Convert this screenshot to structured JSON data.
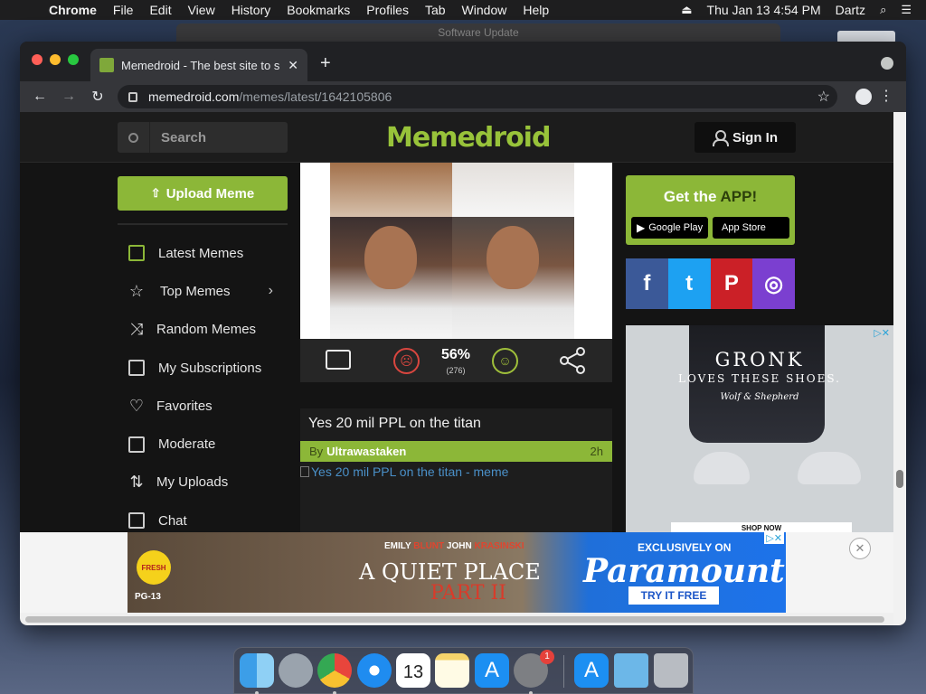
{
  "menubar": {
    "app": "Chrome",
    "items": [
      "File",
      "Edit",
      "View",
      "History",
      "Bookmarks",
      "Profiles",
      "Tab",
      "Window",
      "Help"
    ],
    "datetime": "Thu Jan 13  4:54 PM",
    "user": "Dartz"
  },
  "background_window": {
    "title": "Software Update"
  },
  "browser": {
    "tab_title": "Memedroid - The best site to s",
    "url_host": "memedroid.com",
    "url_path": "/memes/latest/1642105806"
  },
  "site": {
    "search_placeholder": "Search",
    "logo": "Memedroid",
    "signin_label": "Sign In",
    "upload_label": "Upload Meme",
    "menu": [
      {
        "label": "Latest Memes",
        "icon": "latest-memes-icon"
      },
      {
        "label": "Top Memes",
        "icon": "star-icon",
        "chevron": "›"
      },
      {
        "label": "Random Memes",
        "icon": "shuffle-icon"
      },
      {
        "label": "My Subscriptions",
        "icon": "subscriptions-icon"
      },
      {
        "label": "Favorites",
        "icon": "heart-icon"
      },
      {
        "label": "Moderate",
        "icon": "moderate-icon"
      },
      {
        "label": "My Uploads",
        "icon": "uploads-icon"
      },
      {
        "label": "Chat",
        "icon": "chat-icon"
      }
    ],
    "meme_actions": {
      "rating_percent": "56%",
      "votes": "(276)"
    },
    "post": {
      "title": "Yes 20 mil PPL on the titan",
      "by_label": "By",
      "author": "Ultrawastaken",
      "age": "2h",
      "image_alt": "Yes 20 mil PPL on the titan - meme"
    },
    "app_promo": {
      "title_prefix": "Get the ",
      "title_highlight": "APP!",
      "google_play": "Google Play",
      "app_store": "App Store"
    },
    "social": [
      "f",
      "t",
      "P",
      "◎"
    ]
  },
  "ad_right": {
    "brand": "GRONK",
    "tagline": "LOVES THESE SHOES.",
    "signature": "Wolf & Shepherd",
    "cta": "SHOP NOW"
  },
  "ad_banner": {
    "badge": "FRESH",
    "rating": "PG-13",
    "cast_1": "EMILY ",
    "cast_1b": "BLUNT",
    "cast_2": "  JOHN ",
    "cast_2b": "KRASINSKI",
    "title_line1": "A QUIET PLACE",
    "title_line2": "PART II",
    "exclusive": "EXCLUSIVELY ON",
    "network": "Paramount+",
    "cta": "TRY IT FREE"
  },
  "dock": {
    "calendar_day": "13",
    "prefs_badge": "1"
  }
}
